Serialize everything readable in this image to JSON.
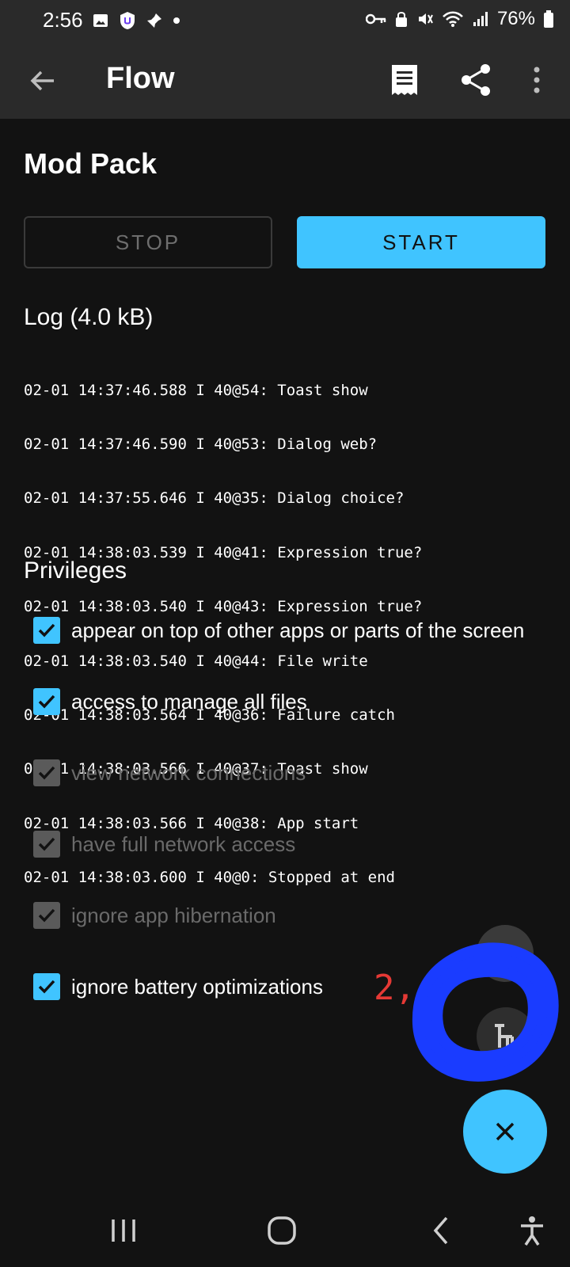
{
  "status_bar": {
    "time": "2:56",
    "battery": "76%",
    "icons": [
      "image-icon",
      "shield-icon",
      "pin-icon",
      "dot-icon",
      "key-icon",
      "lock-icon",
      "mute-icon",
      "wifi-icon",
      "signal-icon",
      "battery-icon"
    ]
  },
  "app_bar": {
    "title": "Flow",
    "actions": [
      "log-icon",
      "share-icon",
      "more-vert-icon"
    ]
  },
  "flow": {
    "name": "Mod Pack",
    "stop_label": "STOP",
    "start_label": "START"
  },
  "log": {
    "title": "Log (4.0 kB)",
    "lines": [
      "02-01 14:37:46.588 I 40@54: Toast show",
      "02-01 14:37:46.590 I 40@53: Dialog web?",
      "02-01 14:37:55.646 I 40@35: Dialog choice?",
      "02-01 14:38:03.539 I 40@41: Expression true?",
      "02-01 14:38:03.540 I 40@43: Expression true?",
      "02-01 14:38:03.540 I 40@44: File write",
      "02-01 14:38:03.564 I 40@36: Failure catch",
      "02-01 14:38:03.566 I 40@37: Toast show",
      "02-01 14:38:03.566 I 40@38: App start",
      "02-01 14:38:03.600 I 40@0: Stopped at end"
    ]
  },
  "privileges": {
    "title": "Privileges",
    "items": [
      {
        "label": "appear on top of other apps or parts of the screen",
        "checked": true,
        "enabled": true
      },
      {
        "label": "access to manage all files",
        "checked": true,
        "enabled": true
      },
      {
        "label": "view network connections",
        "checked": true,
        "enabled": false
      },
      {
        "label": "have full network access",
        "checked": true,
        "enabled": false
      },
      {
        "label": "ignore app hibernation",
        "checked": true,
        "enabled": false
      },
      {
        "label": "ignore battery optimizations",
        "checked": true,
        "enabled": true
      }
    ]
  },
  "annotation": {
    "number": "2",
    "comma": ","
  },
  "colors": {
    "accent": "#40c4ff",
    "annotation_red": "#e53935",
    "annotation_blue": "#1a3cff"
  }
}
